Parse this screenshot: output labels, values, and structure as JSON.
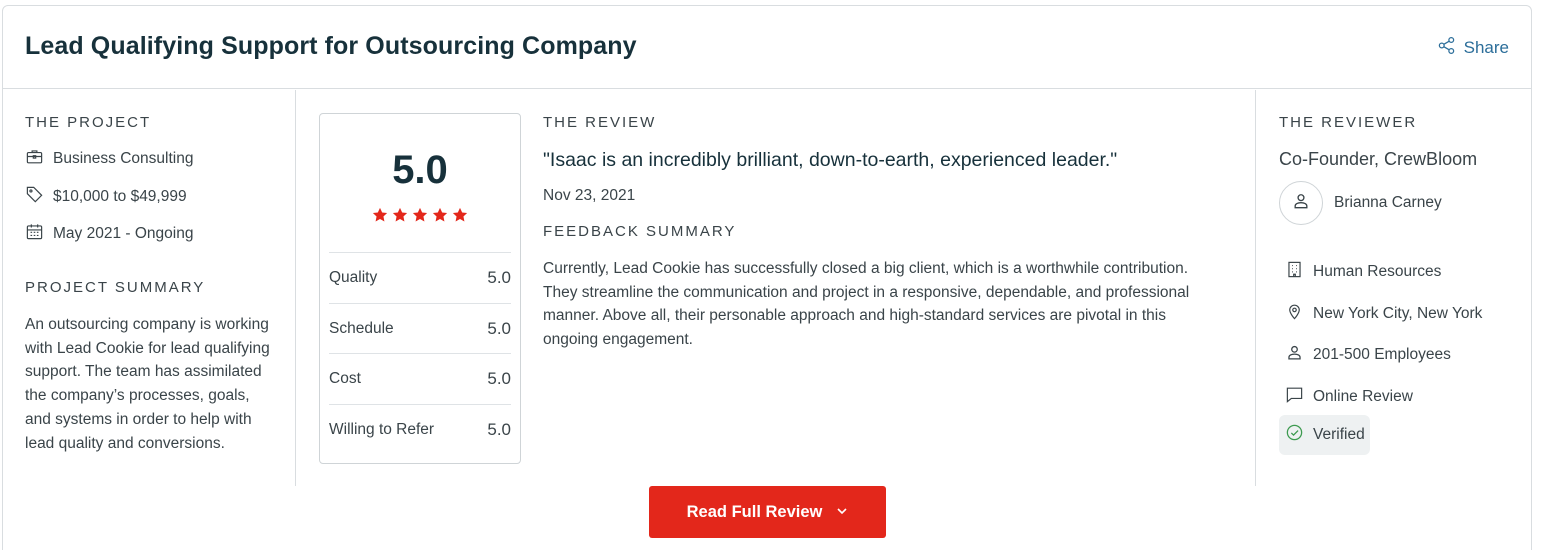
{
  "header": {
    "title": "Lead Qualifying Support for Outsourcing Company",
    "share_label": "Share"
  },
  "project": {
    "section_label": "THE PROJECT",
    "category": "Business Consulting",
    "budget": "$10,000 to $49,999",
    "timeline": "May 2021 - Ongoing",
    "summary_label": "PROJECT SUMMARY",
    "summary": "An outsourcing company is working with Lead Cookie for lead qualifying support. The team has assimilated the company’s processes, goals, and systems in order to help with lead quality and conversions."
  },
  "rating": {
    "overall": "5.0",
    "stars": 5,
    "rows": [
      {
        "label": "Quality",
        "value": "5.0"
      },
      {
        "label": "Schedule",
        "value": "5.0"
      },
      {
        "label": "Cost",
        "value": "5.0"
      },
      {
        "label": "Willing to Refer",
        "value": "5.0"
      }
    ]
  },
  "review": {
    "section_label": "THE REVIEW",
    "quote": "\"Isaac is an incredibly brilliant, down-to-earth, experienced leader.\"",
    "date": "Nov 23, 2021",
    "feedback_label": "FEEDBACK SUMMARY",
    "feedback": "Currently, Lead Cookie has successfully closed a big client, which is a worthwhile contribution. They streamline the communication and project in a responsive, dependable, and professional manner. Above all, their personable approach and high-standard services are pivotal in this ongoing engagement."
  },
  "reviewer": {
    "section_label": "THE REVIEWER",
    "role": "Co-Founder, CrewBloom",
    "name": "Brianna Carney",
    "industry": "Human Resources",
    "location": "New York City, New York",
    "company_size": "201-500 Employees",
    "review_type": "Online Review",
    "verified_label": "Verified"
  },
  "actions": {
    "read_full_review": "Read Full Review"
  },
  "colors": {
    "accent_red": "#e3271b",
    "star_red": "#e3271b",
    "link_blue": "#2c6e9a",
    "verified_green": "#3c9a4f"
  }
}
